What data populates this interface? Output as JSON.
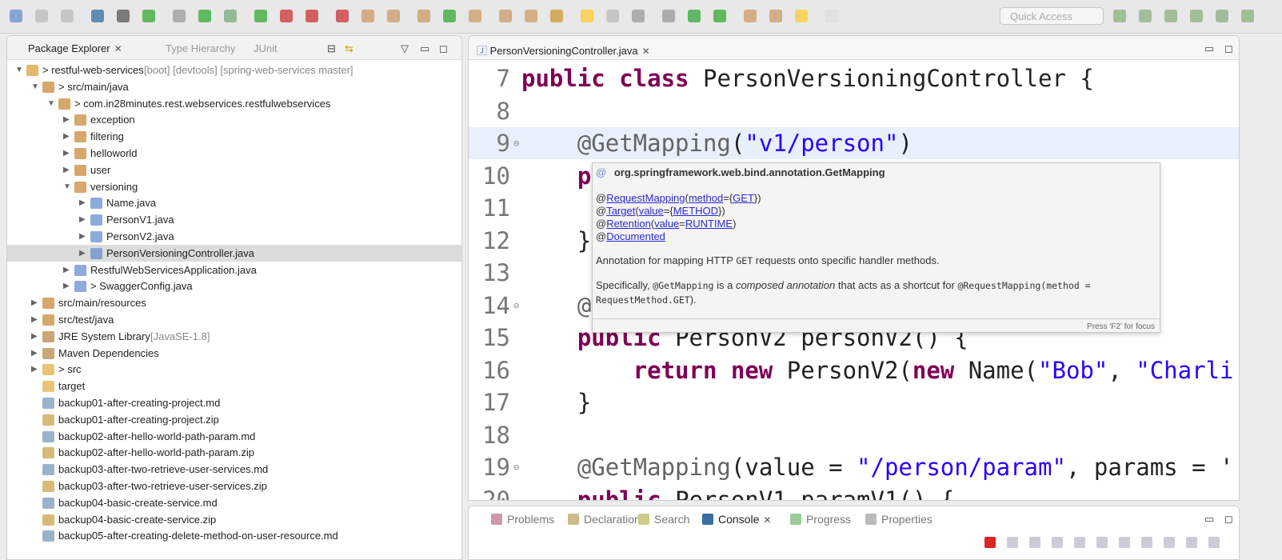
{
  "toolbar": {
    "quick_access_placeholder": "Quick Access",
    "icons": [
      "new-icon",
      "save-icon",
      "save-all-icon",
      "terminal-icon",
      "skip-breakpoints-icon",
      "spring-boot-icon",
      "toggle-mark-icon",
      "spring-icon",
      "debug-icon",
      "run-icon",
      "run-config-icon",
      "stop-icon",
      "external-tools-icon",
      "new-java-project-icon",
      "new-package-icon",
      "new-class-icon",
      "open-type-icon",
      "open-task-icon",
      "search-icon",
      "open-folder-icon",
      "spring-tool-icon",
      "highlight-icon",
      "toggle-block-icon",
      "show-whitespace-icon",
      "green-run-icon",
      "green-square-icon",
      "next-annotation-icon",
      "prev-annotation-icon",
      "last-edit-icon",
      "back-icon",
      "forward-icon"
    ],
    "perspective_icons": [
      "open-perspective-icon",
      "java-ee-icon",
      "git-icon",
      "debug-perspective-icon",
      "java-perspective-icon",
      "spring-perspective-icon"
    ]
  },
  "package_explorer": {
    "tabs": [
      {
        "label": "Package Explorer",
        "active": true
      },
      {
        "label": "Type Hierarchy"
      },
      {
        "label": "JUnit"
      }
    ],
    "tree": [
      {
        "label": "> restful-web-services",
        "suffix": " [boot] [devtools] [spring-web-services master]",
        "indent": 0,
        "arrow": "open",
        "icon": "project"
      },
      {
        "label": "> src/main/java",
        "indent": 1,
        "arrow": "open",
        "icon": "srcfolder"
      },
      {
        "label": "> com.in28minutes.rest.webservices.restfulwebservices",
        "indent": 2,
        "arrow": "open",
        "icon": "package"
      },
      {
        "label": "exception",
        "indent": 3,
        "arrow": "closed",
        "icon": "package"
      },
      {
        "label": "filtering",
        "indent": 3,
        "arrow": "closed",
        "icon": "package"
      },
      {
        "label": "helloworld",
        "indent": 3,
        "arrow": "closed",
        "icon": "package"
      },
      {
        "label": "user",
        "indent": 3,
        "arrow": "closed",
        "icon": "package"
      },
      {
        "label": "versioning",
        "indent": 3,
        "arrow": "open",
        "icon": "package"
      },
      {
        "label": "Name.java",
        "indent": 4,
        "arrow": "closed",
        "icon": "java"
      },
      {
        "label": "PersonV1.java",
        "indent": 4,
        "arrow": "closed",
        "icon": "java"
      },
      {
        "label": "PersonV2.java",
        "indent": 4,
        "arrow": "closed",
        "icon": "java"
      },
      {
        "label": "PersonVersioningController.java",
        "indent": 4,
        "arrow": "closed",
        "icon": "java",
        "selected": true
      },
      {
        "label": "RestfulWebServicesApplication.java",
        "indent": 3,
        "arrow": "closed",
        "icon": "java"
      },
      {
        "label": "> SwaggerConfig.java",
        "indent": 3,
        "arrow": "closed",
        "icon": "java"
      },
      {
        "label": "src/main/resources",
        "indent": 1,
        "arrow": "closed",
        "icon": "srcfolder"
      },
      {
        "label": "src/test/java",
        "indent": 1,
        "arrow": "closed",
        "icon": "srcfolder"
      },
      {
        "label": "JRE System Library",
        "suffix": " [JavaSE-1.8]",
        "indent": 1,
        "arrow": "closed",
        "icon": "library"
      },
      {
        "label": "Maven Dependencies",
        "indent": 1,
        "arrow": "closed",
        "icon": "library"
      },
      {
        "label": "> src",
        "indent": 1,
        "arrow": "closed",
        "icon": "folder"
      },
      {
        "label": "target",
        "indent": 1,
        "arrow": "none",
        "icon": "folder"
      },
      {
        "label": "backup01-after-creating-project.md",
        "indent": 1,
        "arrow": "none",
        "icon": "file"
      },
      {
        "label": "backup01-after-creating-project.zip",
        "indent": 1,
        "arrow": "none",
        "icon": "zip"
      },
      {
        "label": "backup02-after-hello-world-path-param.md",
        "indent": 1,
        "arrow": "none",
        "icon": "file"
      },
      {
        "label": "backup02-after-hello-world-path-param.zip",
        "indent": 1,
        "arrow": "none",
        "icon": "zip"
      },
      {
        "label": "backup03-after-two-retrieve-user-services.md",
        "indent": 1,
        "arrow": "none",
        "icon": "file"
      },
      {
        "label": "backup03-after-two-retrieve-user-services.zip",
        "indent": 1,
        "arrow": "none",
        "icon": "zip"
      },
      {
        "label": "backup04-basic-create-service.md",
        "indent": 1,
        "arrow": "none",
        "icon": "file"
      },
      {
        "label": "backup04-basic-create-service.zip",
        "indent": 1,
        "arrow": "none",
        "icon": "zip"
      },
      {
        "label": "backup05-after-creating-delete-method-on-user-resource.md",
        "indent": 1,
        "arrow": "none",
        "icon": "file"
      }
    ]
  },
  "editor": {
    "tab": "PersonVersioningController.java",
    "lines": [
      {
        "n": "7",
        "tokens": [
          [
            "public class ",
            "kw"
          ],
          [
            "PersonVersioningController {",
            ""
          ]
        ]
      },
      {
        "n": "8",
        "tokens": []
      },
      {
        "n": "9",
        "fold": true,
        "current": true,
        "tokens": [
          [
            "    @GetMapping",
            "ann"
          ],
          [
            "(",
            ""
          ],
          [
            "\"v1/person\"",
            "str"
          ],
          [
            ")",
            ""
          ]
        ]
      },
      {
        "n": "10",
        "tokens": [
          [
            "    p",
            "kw"
          ]
        ]
      },
      {
        "n": "11",
        "tokens": []
      },
      {
        "n": "12",
        "tokens": [
          [
            "    }",
            ""
          ]
        ]
      },
      {
        "n": "13",
        "tokens": []
      },
      {
        "n": "14",
        "fold": true,
        "tokens": [
          [
            "    @",
            "ann"
          ]
        ]
      },
      {
        "n": "15",
        "tokens": [
          [
            "    public ",
            "kw"
          ],
          [
            "PersonV2 personV2() {",
            ""
          ]
        ]
      },
      {
        "n": "16",
        "tokens": [
          [
            "        return new ",
            "kw"
          ],
          [
            "PersonV2(",
            ""
          ],
          [
            "new ",
            "kw"
          ],
          [
            "Name(",
            ""
          ],
          [
            "\"Bob\"",
            "str"
          ],
          [
            ", ",
            ""
          ],
          [
            "\"Charli",
            "str"
          ]
        ]
      },
      {
        "n": "17",
        "tokens": [
          [
            "    }",
            ""
          ]
        ]
      },
      {
        "n": "18",
        "tokens": []
      },
      {
        "n": "19",
        "fold": true,
        "tokens": [
          [
            "    @GetMapping",
            "ann"
          ],
          [
            "(value = ",
            ""
          ],
          [
            "\"/person/param\"",
            "str"
          ],
          [
            ", params = '",
            ""
          ]
        ]
      },
      {
        "n": "20",
        "tokens": [
          [
            "    public ",
            "kw"
          ],
          [
            "PersonV1 paramV1() {",
            ""
          ]
        ]
      }
    ]
  },
  "tooltip": {
    "title": "org.springframework.web.bind.annotation.GetMapping",
    "annotations": [
      [
        [
          "@",
          0
        ],
        [
          "RequestMapping",
          1
        ],
        [
          "(",
          0
        ],
        [
          "method",
          1
        ],
        [
          "={",
          0
        ],
        [
          "GET",
          1
        ],
        [
          "})",
          0
        ]
      ],
      [
        [
          "@",
          0
        ],
        [
          "Target",
          1
        ],
        [
          "(",
          0
        ],
        [
          "value",
          1
        ],
        [
          "={",
          0
        ],
        [
          "METHOD",
          1
        ],
        [
          "})",
          0
        ]
      ],
      [
        [
          "@",
          0
        ],
        [
          "Retention",
          1
        ],
        [
          "(",
          0
        ],
        [
          "value",
          1
        ],
        [
          "=",
          0
        ],
        [
          "RUNTIME",
          1
        ],
        [
          ")",
          0
        ]
      ],
      [
        [
          "@",
          0
        ],
        [
          "Documented",
          1
        ]
      ]
    ],
    "desc_pre": "Annotation for mapping HTTP ",
    "desc_code": "GET",
    "desc_post": " requests onto specific handler methods.",
    "spec_1": "Specifically, ",
    "spec_code1": "@GetMapping",
    "spec_2": " is a ",
    "spec_em": "composed annotation",
    "spec_3": " that acts as a shortcut for ",
    "spec_code2": "@RequestMapping(method =",
    "spec_code3": "RequestMethod.GET",
    "spec_4": ").",
    "footer": "Press 'F2' for focus"
  },
  "bottom_panel": {
    "tabs": [
      {
        "label": "Problems"
      },
      {
        "label": "Declaration"
      },
      {
        "label": "Search"
      },
      {
        "label": "Console",
        "active": true
      },
      {
        "label": "Progress"
      },
      {
        "label": "Properties"
      }
    ]
  },
  "colors": {
    "keyword": "#7f0055",
    "string": "#2a00ff",
    "annotation": "#646464",
    "link": "#2a2ad0",
    "selection": "#dcdcdc",
    "current_line": "#e8f0fb"
  }
}
